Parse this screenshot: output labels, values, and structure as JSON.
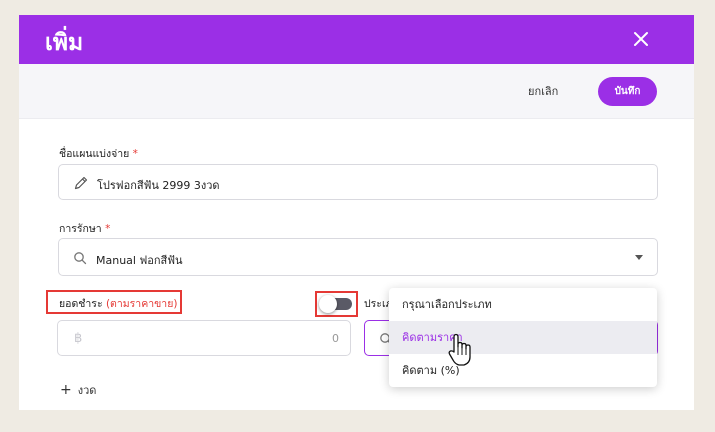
{
  "modal": {
    "title": "เพิ่ม"
  },
  "toolbar": {
    "cancel_label": "ยกเลิก",
    "save_label": "บันทึก"
  },
  "form": {
    "plan_name": {
      "label": "ชื่อแผนแบ่งจ่าย",
      "required_mark": "*",
      "value": "โปรฟอกสีฟัน 2999 3งวด"
    },
    "treatment": {
      "label": "การรักษา",
      "required_mark": "*",
      "value": "Manual ฟอกสีฟัน"
    },
    "payment": {
      "label": "ยอดชำระ",
      "label_note": "(ตามราคาขาย)",
      "currency_symbol": "฿",
      "value": "0"
    },
    "type": {
      "label": "ประเภ"
    },
    "add_installment_label": "งวด"
  },
  "dropdown": {
    "options": [
      "กรุณาเลือกประเภท",
      "คิดตามราคา",
      "คิดตาม (%)"
    ],
    "selected_index": 1
  },
  "colors": {
    "accent": "#9b2fe6",
    "highlight": "#e53935"
  }
}
